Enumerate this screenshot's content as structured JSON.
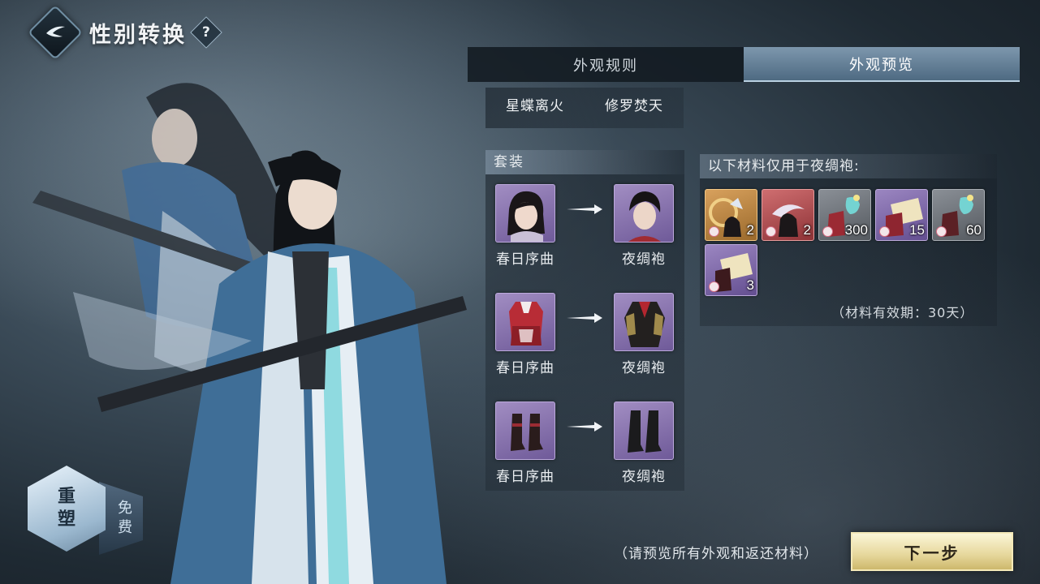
{
  "header": {
    "title": "性别转换",
    "help": "?"
  },
  "tabs": [
    {
      "label": "外观规则",
      "active": false
    },
    {
      "label": "外观预览",
      "active": true
    }
  ],
  "weapons": [
    "星蝶离火",
    "修罗焚天"
  ],
  "outfit": {
    "heading": "套装",
    "rows": [
      {
        "from_label": "春日序曲",
        "to_label": "夜绸袍",
        "kind": "hair"
      },
      {
        "from_label": "春日序曲",
        "to_label": "夜绸袍",
        "kind": "clothes"
      },
      {
        "from_label": "春日序曲",
        "to_label": "夜绸袍",
        "kind": "boots"
      }
    ]
  },
  "materials": {
    "heading": "以下材料仅用于夜绸袍:",
    "items": [
      {
        "count": "2",
        "rarity": "orange",
        "icon": "ring-item-icon"
      },
      {
        "count": "2",
        "rarity": "red",
        "icon": "moon-item-icon"
      },
      {
        "count": "300",
        "rarity": "grey",
        "icon": "bag-item-icon"
      },
      {
        "count": "15",
        "rarity": "purple",
        "icon": "scroll-item-icon"
      },
      {
        "count": "60",
        "rarity": "grey",
        "icon": "bag-item-icon"
      },
      {
        "count": "3",
        "rarity": "purple",
        "icon": "scroll-item-icon"
      }
    ],
    "validity": "（材料有效期：30天）"
  },
  "rebuild": {
    "title_line1": "重",
    "title_line2": "塑",
    "free_line1": "免",
    "free_line2": "费"
  },
  "footer": {
    "hint": "（请预览所有外观和返还材料）",
    "next_label": "下一步"
  },
  "colors": {
    "accent": "#6f8ba3",
    "next_button": "#e6d79b",
    "rarity_purple": "#9b86c1",
    "rarity_orange": "#d8a15d"
  }
}
